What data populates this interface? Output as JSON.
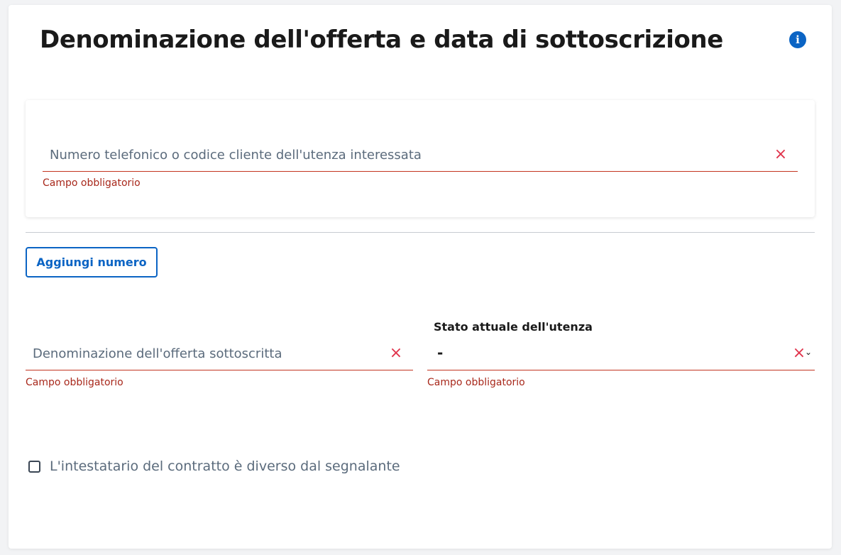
{
  "header": {
    "title": "Denominazione dell'offerta e data di sottoscrizione",
    "info_icon": "info-icon"
  },
  "phone_section": {
    "phone_field": {
      "placeholder": "Numero telefonico o codice cliente dell'utenza interessata",
      "value": "",
      "error": "Campo obbligatorio",
      "clear_icon": "×"
    },
    "add_button_label": "Aggiungi numero"
  },
  "offer_field": {
    "placeholder": "Denominazione dell'offerta sottoscritta",
    "value": "",
    "error": "Campo obbligatorio",
    "clear_icon": "×"
  },
  "status_select": {
    "label": "Stato attuale dell'utenza",
    "selected_value": "-",
    "error": "Campo obbligatorio",
    "clear_icon": "×",
    "chevron": "⌄"
  },
  "holder_checkbox": {
    "label": "L'intestatario del contratto è diverso dal segnalante",
    "checked": false
  },
  "colors": {
    "accent": "#0b64c4",
    "error": "#c3341f",
    "error_text": "#a8281b",
    "clear_icon": "#e0334b"
  }
}
